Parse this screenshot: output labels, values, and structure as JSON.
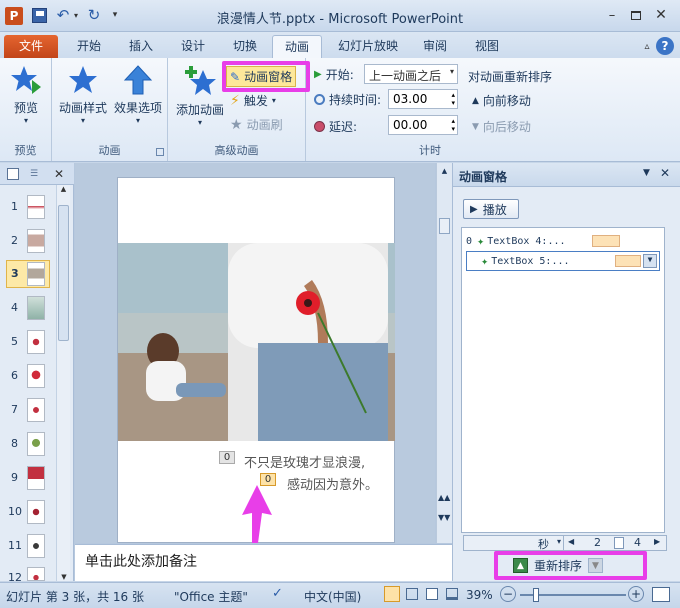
{
  "window": {
    "title": "浪漫情人节.pptx - Microsoft PowerPoint",
    "app_icon": "P"
  },
  "tabs": [
    {
      "label": "文件"
    },
    {
      "label": "开始"
    },
    {
      "label": "插入"
    },
    {
      "label": "设计"
    },
    {
      "label": "切换"
    },
    {
      "label": "动画"
    },
    {
      "label": "幻灯片放映"
    },
    {
      "label": "审阅"
    },
    {
      "label": "视图"
    }
  ],
  "ribbon": {
    "preview": {
      "button": "预览",
      "group": "预览"
    },
    "animation": {
      "style": "动画样式",
      "options": "效果选项",
      "group": "动画"
    },
    "advanced": {
      "add": "添加动画",
      "pane": "动画窗格",
      "trigger": "触发",
      "painter": "动画刷",
      "group": "高级动画"
    },
    "timing": {
      "start_label": "开始:",
      "start_value": "上一动画之后",
      "duration_label": "持续时间:",
      "duration_value": "03.00",
      "delay_label": "延迟:",
      "delay_value": "00.00",
      "group": "计时"
    },
    "reorder": {
      "title": "对动画重新排序",
      "forward": "向前移动",
      "backward": "向后移动"
    }
  },
  "slides_panel": {
    "numbers": [
      "1",
      "2",
      "3",
      "4",
      "5",
      "6",
      "7",
      "8",
      "9",
      "10",
      "11",
      "12"
    ],
    "selected": "3"
  },
  "slide": {
    "text_line1": "不只是玫瑰才显浪漫,",
    "text_line2": "感动因为意外。",
    "tag1": "0",
    "tag2": "0"
  },
  "notes": {
    "placeholder": "单击此处添加备注"
  },
  "anim_pane": {
    "title": "动画窗格",
    "play": "播放",
    "items": [
      {
        "num": "0",
        "label": "TextBox 4:..."
      },
      {
        "num": "",
        "label": "TextBox 5:..."
      }
    ],
    "timeline_unit": "秒",
    "timeline_ticks": [
      "2",
      "4"
    ],
    "reorder_label": "重新排序"
  },
  "status": {
    "slide_info": "幻灯片 第 3 张，共 16 张",
    "theme": "\"Office 主题\"",
    "language": "中文(中国)",
    "zoom": "39%"
  },
  "colors": {
    "highlight": "#e83ee8",
    "file_tab": "#d2541f",
    "accent_blue": "#1e5fb4"
  }
}
